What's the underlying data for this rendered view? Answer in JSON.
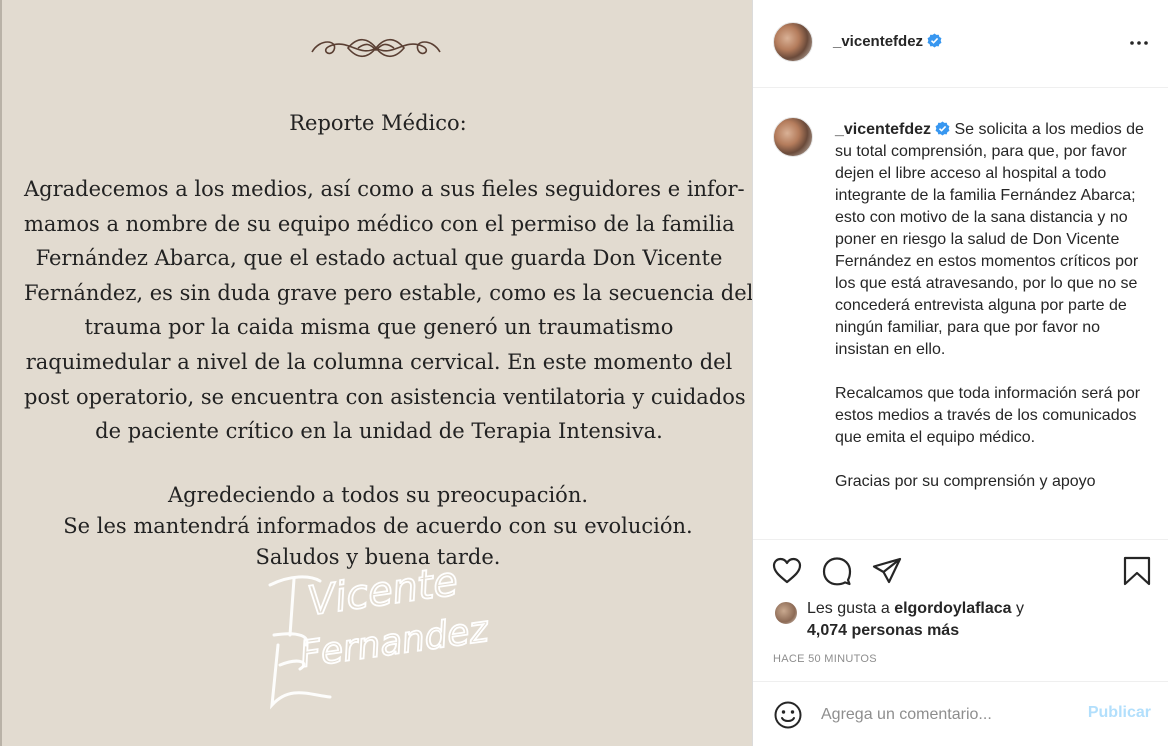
{
  "post_image": {
    "heading": "Reporte Médico:",
    "body_lines": [
      "Agradecemos a los medios, así como a sus fieles seguidores e infor-",
      "mamos a nombre de su equipo médico con el permiso de la familia",
      "Fernández Abarca, que el estado actual que guarda Don Vicente",
      "Fernández, es sin duda grave pero estable, como es la secuencia del",
      "trauma por la caida misma que generó un traumatismo",
      "raquimedular a nivel de la columna cervical. En este momento del",
      "post operatorio, se encuentra con asistencia ventilatoria y cuidados",
      "de paciente crítico en la unidad de Terapia Intensiva."
    ],
    "closing_lines": [
      "Agredeciendo a todos su preocupación.",
      "Se les mantendrá informados de acuerdo con su evolución.",
      "Saludos y buena tarde."
    ],
    "signature_line1": "Vicente",
    "signature_line2": "Fernandez"
  },
  "header": {
    "username": "_vicentefdez",
    "verified_icon": "verified-badge-icon",
    "more_icon": "more-options-icon"
  },
  "caption": {
    "username": "_vicentefdez",
    "paragraphs": [
      "Se solicita a los medios de su total comprensión, para que, por favor dejen el libre acceso al hospital a todo integrante de la familia Fernández Abarca; esto con motivo de la sana distancia y no poner en riesgo la salud de Don Vicente Fernández en estos momentos críticos por los que está atravesando, por lo que no se concederá entrevista alguna por parte de ningún familiar, para que por favor no insistan en ello.",
      "Recalcamos que toda información será por estos medios a través de los comunicados que emita el equipo médico.",
      "Gracias por su comprensión y apoyo"
    ]
  },
  "actions": {
    "icons": [
      "heart-icon",
      "comment-icon",
      "share-icon",
      "bookmark-icon"
    ],
    "likes_prefix": "Les gusta a",
    "likes_user": "elgordoylaflaca",
    "likes_and": "y",
    "likes_count": "4,074 personas más",
    "time": "HACE 50 MINUTOS"
  },
  "comment": {
    "placeholder": "Agrega un comentario...",
    "publish_label": "Publicar",
    "emoji_icon": "emoji-icon"
  },
  "colors": {
    "image_bg": "#e2dbd0",
    "verified_blue": "#3897f0",
    "publish_disabled": "#b2dffc",
    "meta_gray": "#8e8e8e"
  }
}
